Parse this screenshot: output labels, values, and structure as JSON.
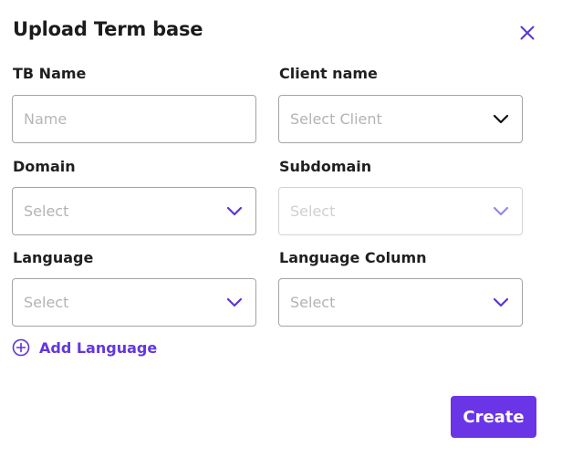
{
  "dialog": {
    "title": "Upload Term base",
    "close_icon": "close-icon",
    "accent_color": "#6a35e6"
  },
  "fields": {
    "tb_name": {
      "label": "TB Name",
      "placeholder": "Name",
      "value": ""
    },
    "client_name": {
      "label": "Client name",
      "placeholder": "Select Client",
      "icon": "chevron-down-icon",
      "icon_color": "#111111"
    },
    "domain": {
      "label": "Domain",
      "placeholder": "Select",
      "icon": "chevron-down-icon",
      "icon_color": "#5b35d6"
    },
    "subdomain": {
      "label": "Subdomain",
      "placeholder": "Select",
      "disabled": true,
      "icon": "chevron-down-icon",
      "icon_color": "#9b86e6"
    },
    "language": {
      "label": "Language",
      "placeholder": "Select",
      "icon": "chevron-down-icon",
      "icon_color": "#5b35d6"
    },
    "language_column": {
      "label": "Language Column",
      "placeholder": "Select",
      "icon": "chevron-down-icon",
      "icon_color": "#5b35d6"
    }
  },
  "actions": {
    "add_language_label": "Add Language",
    "add_language_icon": "plus-circle-icon",
    "create_label": "Create"
  }
}
